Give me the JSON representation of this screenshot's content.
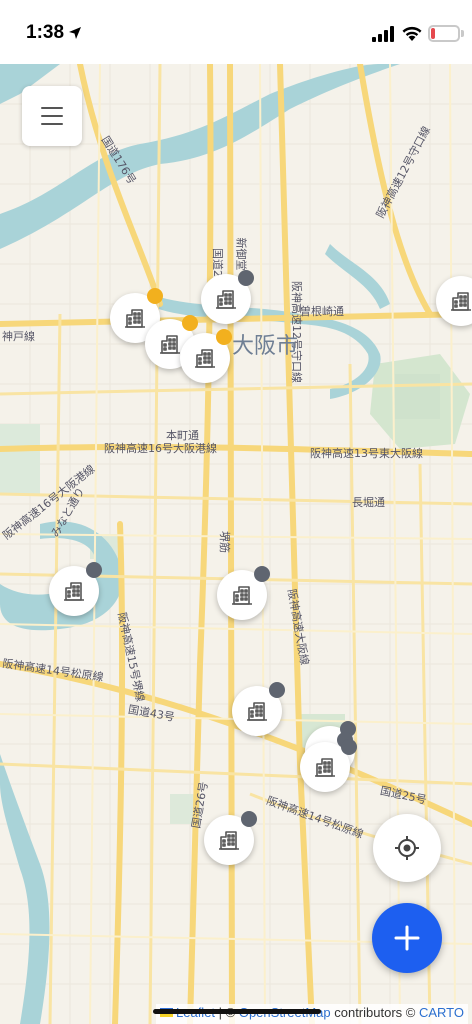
{
  "status_bar": {
    "time": "1:38",
    "battery": "17",
    "battery_level": 0.17,
    "colors": {
      "battery_low": "#e5484d"
    }
  },
  "map": {
    "city_label": "大阪市",
    "labels": {
      "route176": "国道176号",
      "shinmido": "新御堂",
      "nishiumeda": "国道2号",
      "hanshin12": "阪神高速12号守口線",
      "hanshin12b": "阪神高速12号守口線",
      "sonezaki": "曽根崎通",
      "kobe": "神戸線",
      "honmachi": "本町通",
      "hanshin16": "阪神高速16号大阪港線",
      "hanshin13": "阪神高速13号東大阪線",
      "nagahori": "長堀通",
      "minatodori": "みなと通り",
      "osakako": "阪神高速16号大阪港線",
      "sakaisuji": "堺筋",
      "hanshin15": "阪神高速15号堺線",
      "matsubara": "阪神高速14号松原線",
      "route43": "国道43号",
      "route26": "国道26号",
      "route25": "国道25号",
      "hanshin14": "阪神高速14号松原線",
      "osakaline": "阪神高速大阪線",
      "route2b": "国道2号"
    }
  },
  "markers": [
    {
      "name": "building-marker-1",
      "dot": "yellow"
    },
    {
      "name": "building-marker-2",
      "dot": "yellow"
    },
    {
      "name": "building-marker-3",
      "dot": "yellow"
    },
    {
      "name": "building-marker-4",
      "dot": "gray"
    },
    {
      "name": "building-marker-5",
      "dot": "none"
    },
    {
      "name": "building-marker-6",
      "dot": "gray"
    },
    {
      "name": "building-marker-7",
      "dot": "gray"
    },
    {
      "name": "building-marker-8",
      "dot": "gray"
    },
    {
      "name": "building-marker-9",
      "dot": "gray"
    },
    {
      "name": "building-marker-10",
      "dot": "gray"
    }
  ],
  "icons": {
    "menu": "hamburger-icon",
    "building": "building-icon",
    "locate": "crosshair-icon",
    "add": "plus-icon"
  },
  "colors": {
    "marker_yellow": "#f2b01e",
    "marker_gray": "#5f6570",
    "add_button": "#1d5ff0",
    "water": "#a9d3d8",
    "road": "#f7d77a"
  },
  "attribution": {
    "leaflet": "Leaflet",
    "sep": " | © ",
    "osm": "OpenStreetMap",
    "contributors": " contributors © ",
    "carto": "CARTO"
  }
}
